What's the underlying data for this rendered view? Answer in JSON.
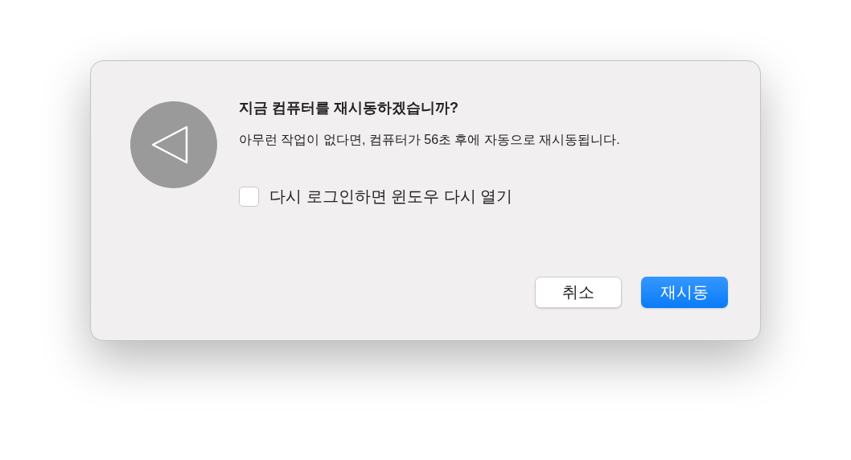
{
  "dialog": {
    "title": "지금 컴퓨터를 재시동하겠습니까?",
    "message": "아무런 작업이 없다면, 컴퓨터가 56초 후에 자동으로 재시동됩니다.",
    "checkbox": {
      "label": "다시 로그인하면 윈도우 다시 열기",
      "checked": false
    },
    "buttons": [
      {
        "label": "취소",
        "primary": false
      },
      {
        "label": "재시동",
        "primary": true
      }
    ]
  }
}
